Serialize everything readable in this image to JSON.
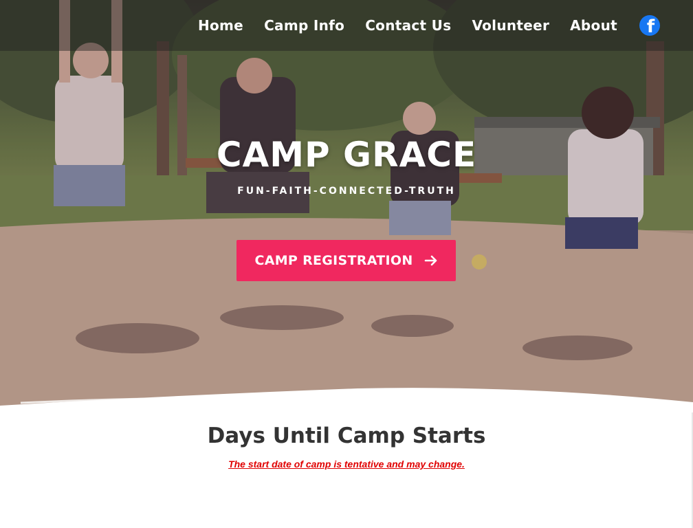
{
  "nav": {
    "items": [
      {
        "label": "Home"
      },
      {
        "label": "Camp Info"
      },
      {
        "label": "Contact Us"
      },
      {
        "label": "Volunteer"
      },
      {
        "label": "About"
      }
    ],
    "social_icon": "facebook-icon",
    "social_icon_color": "#1877f2"
  },
  "hero": {
    "title": "CAMP GRACE",
    "tagline": "FUN-FAITH-CONNECTED-TRUTH",
    "cta_label": "CAMP REGISTRATION",
    "cta_icon": "arrow-right-icon",
    "cta_color": "#f0285f"
  },
  "countdown": {
    "title": "Days Until Camp Starts",
    "note": "The start date of camp is tentative and may change.",
    "note_color": "#e00000"
  }
}
